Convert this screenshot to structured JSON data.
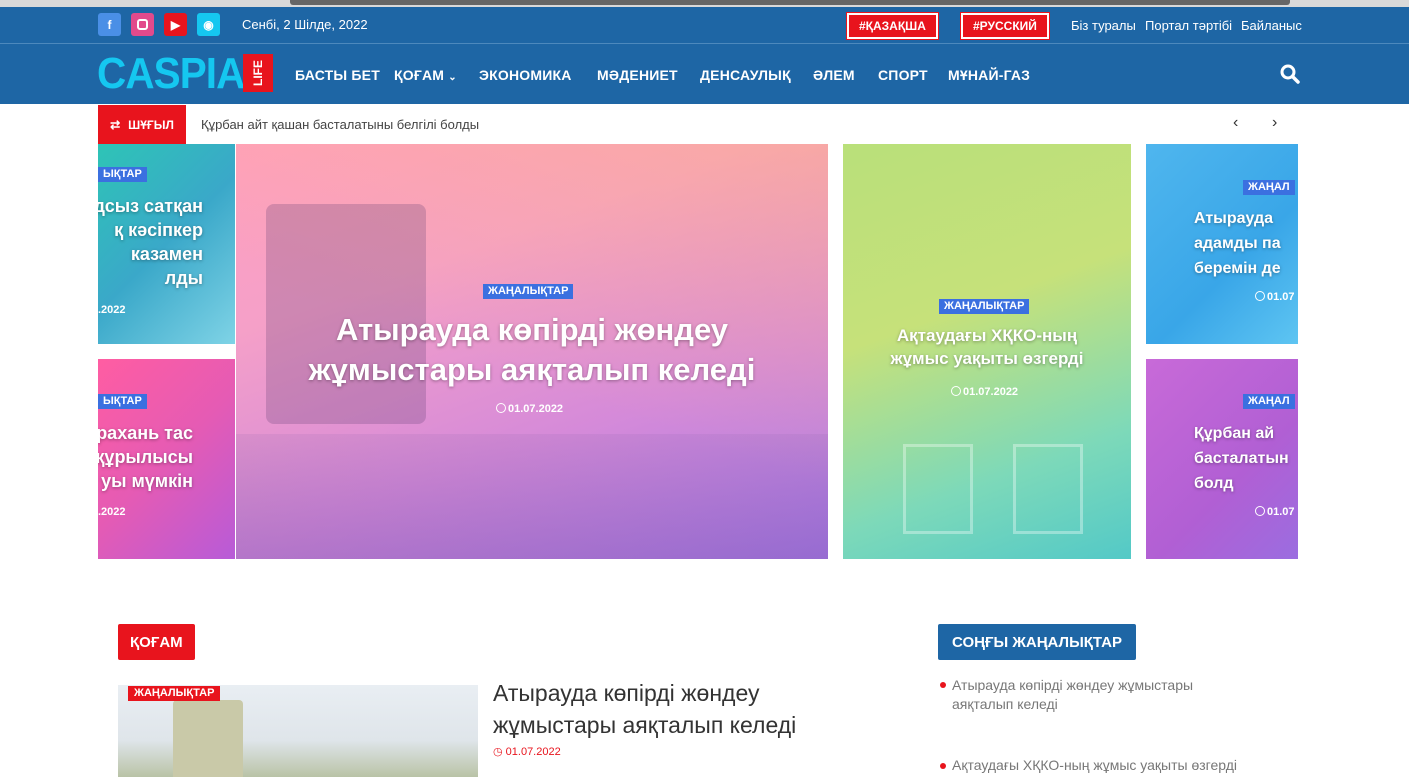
{
  "top": {
    "date": "Сенбі, 2 Шілде, 2022",
    "social": [
      "facebook-icon",
      "instagram-icon",
      "youtube-icon",
      "messenger-icon"
    ],
    "lang": [
      "#ҚАЗАҚША",
      "#РУССКИЙ"
    ],
    "links": [
      "Біз туралы",
      "Портал тәртібі",
      "Байланыс"
    ]
  },
  "logo": {
    "text": "CASPIAN",
    "badge": "LIFE"
  },
  "nav": [
    "БАСТЫ БЕТ",
    "ҚОҒАМ",
    "ЭКОНОМИКА",
    "МӘДЕНИЕТ",
    "ДЕНСАУЛЫҚ",
    "ӘЛЕМ",
    "СПОРТ",
    "МҰНАЙ-ГАЗ"
  ],
  "ticker": {
    "label": "ШҰҒЫЛ",
    "text": "Құрбан айт қашан басталатыны белгілі болды"
  },
  "tiles": {
    "left_top": {
      "cat": "ЫҚТАР",
      "title": "дсыз сатқан\nқ кәсіпкер\nказамен\nлды",
      "date": ".2022"
    },
    "left_bottom": {
      "cat": "ЫҚТАР",
      "title": "рахань тас\nқұрылысы\nуы мүмкін",
      "date": ".2022"
    },
    "center": {
      "cat": "ЖАҢАЛЫҚТАР",
      "title": "Атырауда көпірді жөндеу жұмыстары аяқталып келеді",
      "date": "01.07.2022"
    },
    "right": {
      "cat": "ЖАҢАЛЫҚТАР",
      "title": "Ақтаудағы ХҚКО-ның жұмыс уақыты өзгерді",
      "date": "01.07.2022"
    },
    "far_top": {
      "cat": "ЖАҢАЛ",
      "title": "Атырауда\nадамды па\nберемін де",
      "date": "01.07"
    },
    "far_bottom": {
      "cat": "ЖАҢАЛ",
      "title": "Құрбан ай\nбасталатын\nболд",
      "date": "01.07"
    }
  },
  "section": {
    "header": "ҚОҒАМ",
    "article_cat": "ЖАҢАЛЫҚТАР",
    "article_title": "Атырауда көпірді жөндеу жұмыстары аяқталып келеді",
    "article_date": "01.07.2022"
  },
  "sidebar": {
    "header": "СОҢҒЫ ЖАҢАЛЫҚТАР",
    "items": [
      "Атырауда көпірді жөндеу жұмыстары аяқталып келеді",
      "Ақтаудағы ХҚКО-ның жұмыс уақыты өзгерді"
    ]
  }
}
